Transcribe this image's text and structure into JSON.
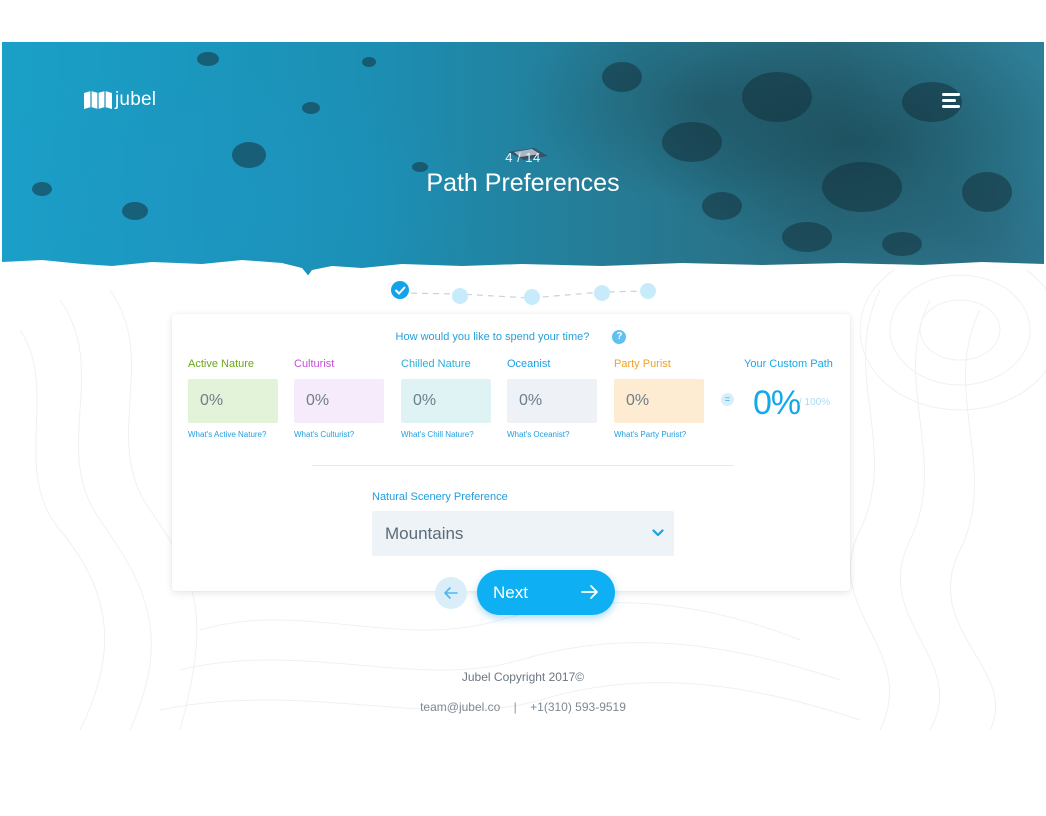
{
  "brand": {
    "name": "jubel"
  },
  "hero": {
    "step": "4 / 14",
    "title": "Path Preferences"
  },
  "progress": {
    "current_step": 1,
    "total_dots": 5
  },
  "preferences": {
    "question": "How would you like to spend your time?",
    "categories": [
      {
        "label": "Active Nature",
        "value": "0%",
        "link": "What's Active Nature?",
        "label_color": "#6aa61c",
        "box_color": "#e3f3d9"
      },
      {
        "label": "Culturist",
        "value": "0%",
        "link": "What's Culturist?",
        "label_color": "#c24fd6",
        "box_color": "#f6ebfb"
      },
      {
        "label": "Chilled Nature",
        "value": "0%",
        "link": "What's Chill Nature?",
        "label_color": "#2bb0d6",
        "box_color": "#dff3f5"
      },
      {
        "label": "Oceanist",
        "value": "0%",
        "link": "What's Oceanist?",
        "label_color": "#1f9ee0",
        "box_color": "#eef2f6"
      },
      {
        "label": "Party Purist",
        "value": "0%",
        "link": "What's Party Purist?",
        "label_color": "#f0a12a",
        "box_color": "#fdebd2"
      }
    ],
    "equals": "=",
    "custom_path": {
      "label": "Your Custom Path",
      "value": "0%",
      "total": "/ 100%"
    }
  },
  "scenery": {
    "label": "Natural Scenery Preference",
    "selected": "Mountains"
  },
  "nav": {
    "next_label": "Next"
  },
  "footer": {
    "copyright": "Jubel Copyright 2017©",
    "email": "team@jubel.co",
    "separator": "|",
    "phone": "+1(310) 593-9519"
  },
  "colors": {
    "accent": "#0fb0f3",
    "link": "#1f9ee0"
  },
  "icons": [
    "map-logo-icon",
    "menu-icon",
    "boat-icon",
    "check-icon",
    "help-icon",
    "chevron-down-icon",
    "arrow-left-icon",
    "arrow-right-icon"
  ]
}
